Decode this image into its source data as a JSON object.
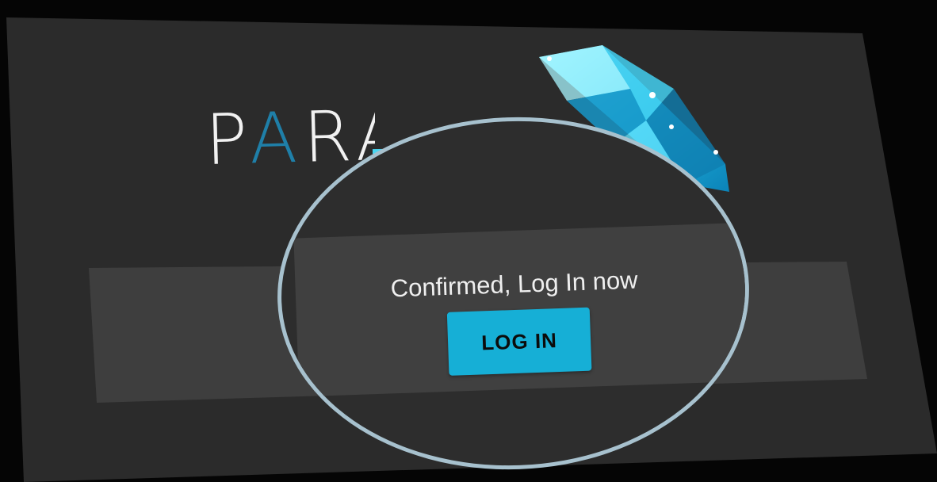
{
  "logo": {
    "text_visible": "PARA",
    "accent_letter": "A",
    "text_prefix": "P",
    "text_suffix": "RA",
    "gem_icon": "diamond-icon",
    "accent_color": "#1ab4de"
  },
  "confirmation": {
    "message": "Confirmed, Log In now",
    "login_button_label": "LOG IN"
  },
  "theme": {
    "background": "#050505",
    "screen": "#2b2b2b",
    "card": "#404040",
    "button": "#16afd6",
    "magnifier_border": "#a7c1ce"
  }
}
